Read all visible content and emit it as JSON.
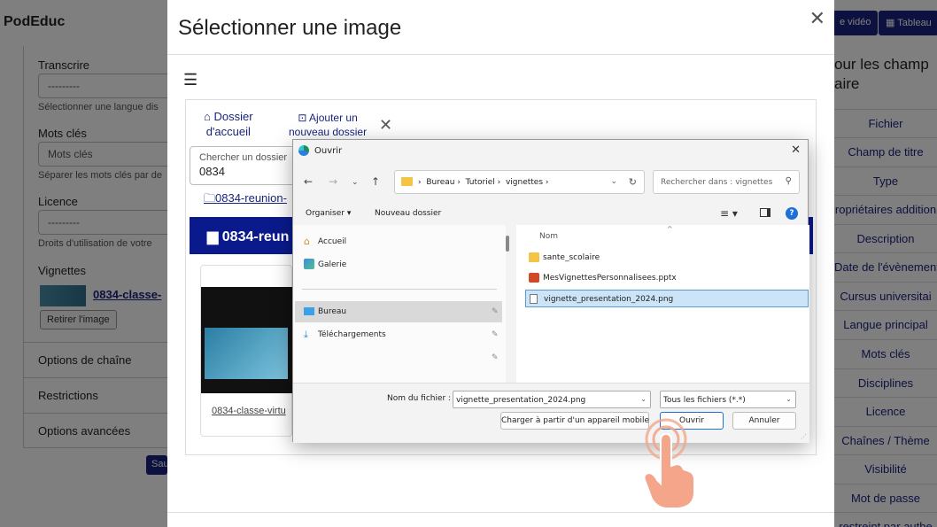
{
  "app": {
    "brand": "PodEduc"
  },
  "header": {
    "btn_video": "e vidéo",
    "btn_dashboard": "Tableau"
  },
  "left_panel": {
    "transcribe_label": "Transcrire",
    "transcribe_value": "---------",
    "transcribe_help": "Sélectionner une langue dis",
    "tags_label": "Mots clés",
    "tags_placeholder": "Mots clés",
    "tags_help": "Séparer les mots clés par de",
    "license_label": "Licence",
    "license_value": "---------",
    "license_help": "Droits d'utilisation de votre",
    "thumbs_label": "Vignettes",
    "thumb_link": "0834-classe-",
    "remove_image": "Retirer l'image",
    "channel_options": "Options de chaîne",
    "restrictions": "Restrictions",
    "advanced": "Options avancées",
    "save": "Sau"
  },
  "right_panel": {
    "title_line1": "our les champ",
    "title_line2": "aire",
    "items": [
      "Fichier",
      "Champ de titre",
      "Type",
      "ropriétaires addition",
      "Description",
      "Date de l'évènement",
      "Cursus universitai",
      "Langue principal",
      "Mots clés",
      "Disciplines",
      "Licence",
      "Chaînes / Thème",
      "Visibilité",
      "Mot de passe",
      "restreint par authe"
    ]
  },
  "modal": {
    "title": "Sélectionner une image",
    "home_line1": "Dossier",
    "home_line2": "d'accueil",
    "add_line1": "Ajouter un",
    "add_line2": "nouveau dossier",
    "search_label": "Chercher un dossier",
    "search_value": "0834",
    "folder_link": "0834-reunion-",
    "current_folder": "0834-reun",
    "card_caption": "0834-classe-virtu"
  },
  "open_dialog": {
    "title": "Ouvrir",
    "breadcrumb": [
      "Bureau",
      "Tutoriel",
      "vignettes"
    ],
    "search_placeholder": "Rechercher dans : vignettes",
    "organize": "Organiser",
    "new_folder": "Nouveau dossier",
    "nav": [
      "Accueil",
      "Galerie",
      "Bureau",
      "Téléchargements"
    ],
    "col_name": "Nom",
    "files": [
      "sante_scolaire",
      "MesVignettesPersonnalisees.pptx",
      "vignette_presentation_2024.png"
    ],
    "filename_label": "Nom du fichier :",
    "filename_value": "vignette_presentation_2024.png",
    "filetype": "Tous les fichiers (*.*)",
    "mobile_btn": "Charger à partir d'un appareil mobile",
    "open_btn": "Ouvrir",
    "cancel_btn": "Annuler"
  },
  "colors": {
    "accent": "#1a237e",
    "windows_blue": "#1e6fd9",
    "hand": "#f4a58a"
  }
}
